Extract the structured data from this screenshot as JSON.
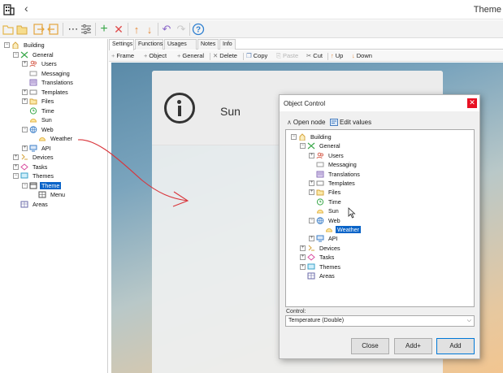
{
  "window": {
    "title": "Theme"
  },
  "tree": [
    {
      "label": "Building",
      "level": 0,
      "exp": "-",
      "icon": "building-icon"
    },
    {
      "label": "General",
      "level": 1,
      "exp": "-",
      "icon": "tools-icon"
    },
    {
      "label": "Users",
      "level": 2,
      "exp": "+",
      "icon": "users-icon"
    },
    {
      "label": "Messaging",
      "level": 2,
      "exp": "",
      "icon": "message-icon"
    },
    {
      "label": "Translations",
      "level": 2,
      "exp": "",
      "icon": "translation-icon"
    },
    {
      "label": "Templates",
      "level": 2,
      "exp": "+",
      "icon": "template-icon"
    },
    {
      "label": "Files",
      "level": 2,
      "exp": "+",
      "icon": "folder-icon"
    },
    {
      "label": "Time",
      "level": 2,
      "exp": "",
      "icon": "clock-icon"
    },
    {
      "label": "Sun",
      "level": 2,
      "exp": "",
      "icon": "sun-icon"
    },
    {
      "label": "Web",
      "level": 2,
      "exp": "-",
      "icon": "globe-icon"
    },
    {
      "label": "Weather",
      "level": 3,
      "exp": "",
      "icon": "weather-icon"
    },
    {
      "label": "API",
      "level": 2,
      "exp": "+",
      "icon": "api-icon"
    },
    {
      "label": "Devices",
      "level": 1,
      "exp": "+",
      "icon": "devices-icon"
    },
    {
      "label": "Tasks",
      "level": 1,
      "exp": "+",
      "icon": "tasks-icon"
    },
    {
      "label": "Themes",
      "level": 1,
      "exp": "-",
      "icon": "themes-icon"
    },
    {
      "label": "Theme",
      "level": 2,
      "exp": "-",
      "icon": "theme-icon",
      "selected": true
    },
    {
      "label": "Menu",
      "level": 3,
      "exp": "",
      "icon": "menu-icon"
    },
    {
      "label": "Areas",
      "level": 1,
      "exp": "",
      "icon": "areas-icon"
    }
  ],
  "tabs": [
    {
      "label": "Settings",
      "active": true
    },
    {
      "label": "Functions"
    },
    {
      "label": "Usages (0)"
    },
    {
      "label": "Notes"
    },
    {
      "label": "Info"
    }
  ],
  "commands": {
    "frame": "Frame",
    "object": "Object",
    "general": "General",
    "delete": "Delete",
    "copy": "Copy",
    "paste": "Paste",
    "cut": "Cut",
    "up": "Up",
    "down": "Down"
  },
  "preview": {
    "label": "Sun"
  },
  "dialog": {
    "title": "Object Control",
    "open_node": "Open node",
    "edit_values": "Edit values",
    "tree": [
      {
        "label": "Building",
        "level": 0,
        "exp": "-",
        "icon": "building-icon"
      },
      {
        "label": "General",
        "level": 1,
        "exp": "-",
        "icon": "tools-icon"
      },
      {
        "label": "Users",
        "level": 2,
        "exp": "+",
        "icon": "users-icon"
      },
      {
        "label": "Messaging",
        "level": 2,
        "exp": "",
        "icon": "message-icon"
      },
      {
        "label": "Translations",
        "level": 2,
        "exp": "",
        "icon": "translation-icon"
      },
      {
        "label": "Templates",
        "level": 2,
        "exp": "+",
        "icon": "template-icon"
      },
      {
        "label": "Files",
        "level": 2,
        "exp": "+",
        "icon": "folder-icon"
      },
      {
        "label": "Time",
        "level": 2,
        "exp": "",
        "icon": "clock-icon"
      },
      {
        "label": "Sun",
        "level": 2,
        "exp": "",
        "icon": "sun-icon"
      },
      {
        "label": "Web",
        "level": 2,
        "exp": "-",
        "icon": "globe-icon"
      },
      {
        "label": "Weather",
        "level": 3,
        "exp": "",
        "icon": "weather-icon",
        "selected": true
      },
      {
        "label": "API",
        "level": 2,
        "exp": "+",
        "icon": "api-icon"
      },
      {
        "label": "Devices",
        "level": 1,
        "exp": "+",
        "icon": "devices-icon"
      },
      {
        "label": "Tasks",
        "level": 1,
        "exp": "+",
        "icon": "tasks-icon"
      },
      {
        "label": "Themes",
        "level": 1,
        "exp": "+",
        "icon": "themes-icon"
      },
      {
        "label": "Areas",
        "level": 1,
        "exp": "",
        "icon": "areas-icon"
      }
    ],
    "control_label": "Control:",
    "control_value": "Temperature (Double)",
    "buttons": {
      "close": "Close",
      "add_plus": "Add+",
      "add": "Add"
    }
  }
}
